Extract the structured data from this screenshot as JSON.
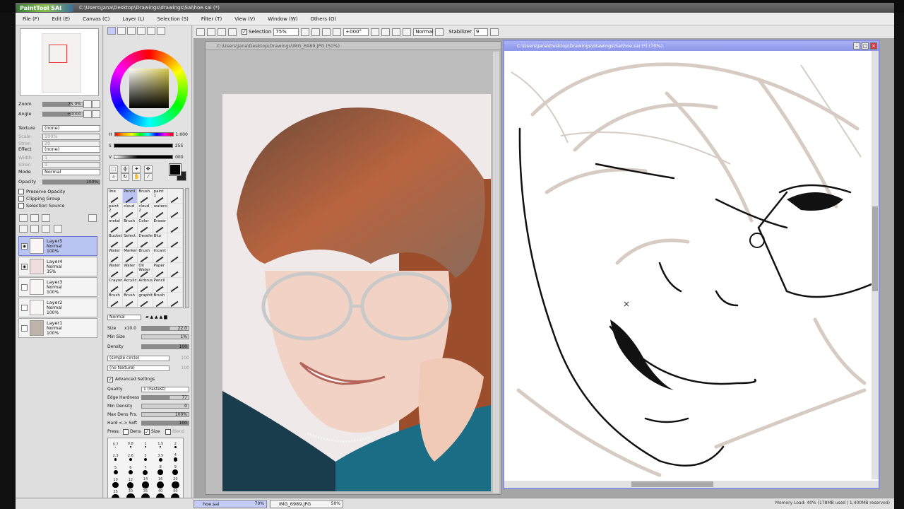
{
  "window": {
    "app_logo": "PaintTool SAI",
    "title": "C:\\Users\\Jana\\Desktop\\Drawings\\drawings\\Sai\\hoe.sai (*)"
  },
  "menu": [
    "File (F)",
    "Edit (E)",
    "Canvas (C)",
    "Layer (L)",
    "Selection (S)",
    "Filter (T)",
    "View (V)",
    "Window (W)",
    "Others (O)"
  ],
  "toolbar": {
    "selection_label": "Selection",
    "zoom": "75%",
    "rotation": "+000°",
    "mode": "Normal",
    "stabilizer_label": "Stabilizer",
    "stabilizer_value": "9"
  },
  "navigator": {
    "zoom_label": "Zoom",
    "zoom_value": "75.0%",
    "angle_label": "Angle",
    "angle_value": "+0000"
  },
  "texture": {
    "texture_label": "Texture",
    "texture_value": "(none)",
    "scale_label": "Scale",
    "scale_value": "100%",
    "strength_label": "Stren",
    "strength_value": "20"
  },
  "effect": {
    "effect_label": "Effect",
    "effect_value": "(none)",
    "width_label": "Width",
    "width_value": "1",
    "strength_label": "Stren",
    "strength_value": "1"
  },
  "layer_props": {
    "mode_label": "Mode",
    "mode_value": "Normal",
    "opacity_label": "Opacity",
    "opacity_value": "100%",
    "preserve_opacity": "Preserve Opacity",
    "clipping_group": "Clipping Group",
    "selection_source": "Selection Source"
  },
  "layers": [
    {
      "name": "Layer5",
      "mode": "Normal",
      "opacity": "100%",
      "selected": true
    },
    {
      "name": "Layer4",
      "mode": "Normal",
      "opacity": "35%",
      "selected": false
    },
    {
      "name": "Layer3",
      "mode": "Normal",
      "opacity": "100%",
      "selected": false
    },
    {
      "name": "Layer2",
      "mode": "Normal",
      "opacity": "100%",
      "selected": false
    },
    {
      "name": "Layer1",
      "mode": "Normal",
      "opacity": "100%",
      "selected": false
    }
  ],
  "hsv": {
    "h_label": "H",
    "h_value": "1:000",
    "s_label": "S",
    "s_value": "255",
    "v_label": "V",
    "v_value": "000"
  },
  "brushes": [
    "line",
    "Pencil",
    "Brush",
    "paint 1",
    "",
    "paint 2",
    "cloud",
    "cloud 2",
    "watercol",
    "",
    "metal",
    "Brush",
    "Color",
    "Eraser",
    "",
    "Bucket",
    "Select",
    "Deselect",
    "Blur",
    "",
    "Water",
    "Marker",
    "Brush",
    "Incant",
    "",
    "Water",
    "Water",
    "Oil Water",
    "Paper",
    "",
    "Crayon",
    "Acrylic",
    "Airbrush",
    "Pencil",
    "",
    "Brush",
    "Brush",
    "graphite",
    "Brush",
    ""
  ],
  "brush_props": {
    "blend_mode": "Normal",
    "size_label": "Size",
    "size_mult": "x10.0",
    "size_value": "22.0",
    "min_size_label": "Min Size",
    "min_size_value": "1%",
    "density_label": "Density",
    "density_value": "100",
    "shape_value": "(simple circle)",
    "shape_amount": "100",
    "texture_value": "(no texture)",
    "texture_amount": "100",
    "advanced_label": "Advanced Settings",
    "quality_label": "Quality",
    "quality_value": "1 (Fastest)",
    "edge_label": "Edge Hardness",
    "edge_value": "77",
    "min_density_label": "Min Density",
    "min_density_value": "0",
    "max_dens_label": "Max Dens Prs.",
    "max_dens_value": "100%",
    "hard_soft_label": "Hard <-> Soft",
    "hard_soft_value": "100",
    "press_label": "Press:",
    "press_dens": "Dens",
    "press_size": "Size",
    "press_blend": "Blend"
  },
  "size_dots": [
    "0.7",
    "0.8",
    "1",
    "1.5",
    "2",
    "2.3",
    "2.6",
    "3",
    "3.5",
    "4",
    "5",
    "6",
    "7",
    "8",
    "9",
    "10",
    "12",
    "14",
    "16",
    "20",
    "25",
    "30",
    "35",
    "40",
    "50"
  ],
  "ref_window": {
    "title": "C:\\Users\\Jana\\Desktop\\Drawings\\IMG_6989.JPG (50%)"
  },
  "draw_window": {
    "title": "C:\\Users\\Jana\\Desktop\\Drawings\\drawings\\Sai\\hoe.sai (*) (70%)"
  },
  "status": {
    "tab1_name": "hoe.sai",
    "tab1_pct": "70%",
    "tab2_name": "IMG_6989.JPG",
    "tab2_pct": "50%",
    "memory": "Memory Load: 40% (178MB used / 1,400MB reserved)"
  },
  "colors": {
    "accent": "#8d96e8",
    "selected_layer": "#b9c4f2"
  }
}
